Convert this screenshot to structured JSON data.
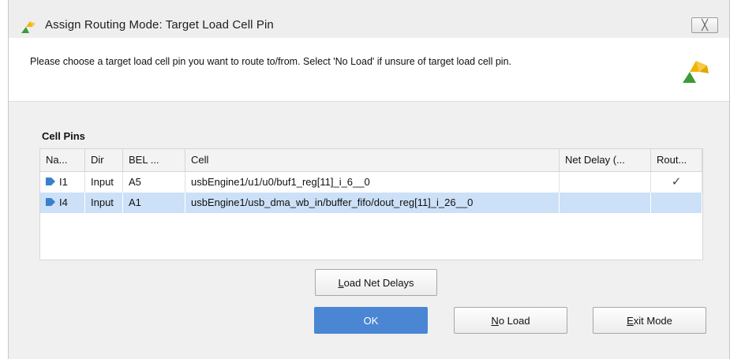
{
  "window": {
    "title": "Assign Routing Mode: Target Load Cell Pin",
    "close_glyph": "╳"
  },
  "instruction": "Please choose a target load cell pin you want to route to/from. Select 'No Load' if unsure of target load cell pin.",
  "section_label": "Cell Pins",
  "table": {
    "columns": [
      "Na...",
      "Dir",
      "BEL ...",
      "Cell",
      "Net Delay (...",
      "Rout..."
    ],
    "rows": [
      {
        "name": "I1",
        "dir": "Input",
        "bel": "A5",
        "cell": "usbEngine1/u1/u0/buf1_reg[11]_i_6__0",
        "net_delay": "",
        "routed": "✓",
        "selected": false
      },
      {
        "name": "I4",
        "dir": "Input",
        "bel": "A1",
        "cell": "usbEngine1/usb_dma_wb_in/buffer_fifo/dout_reg[11]_i_26__0",
        "net_delay": "",
        "routed": "",
        "selected": true
      }
    ]
  },
  "buttons": {
    "load_net_delays": {
      "mnemonic": "L",
      "rest": "oad Net Delays"
    },
    "ok": "OK",
    "no_load": {
      "mnemonic": "N",
      "rest": "o Load"
    },
    "exit_mode": {
      "mnemonic": "E",
      "rest": "xit Mode"
    }
  },
  "icons": {
    "app_logo": "xilinx-logo-icon",
    "pin": "input-pin-icon"
  },
  "colors": {
    "primary_button": "#4a86d3",
    "selected_row": "#cce0f7",
    "logo_green": "#3d9c37",
    "logo_gold": "#f0b400",
    "pin_blue": "#3b7fcc"
  }
}
